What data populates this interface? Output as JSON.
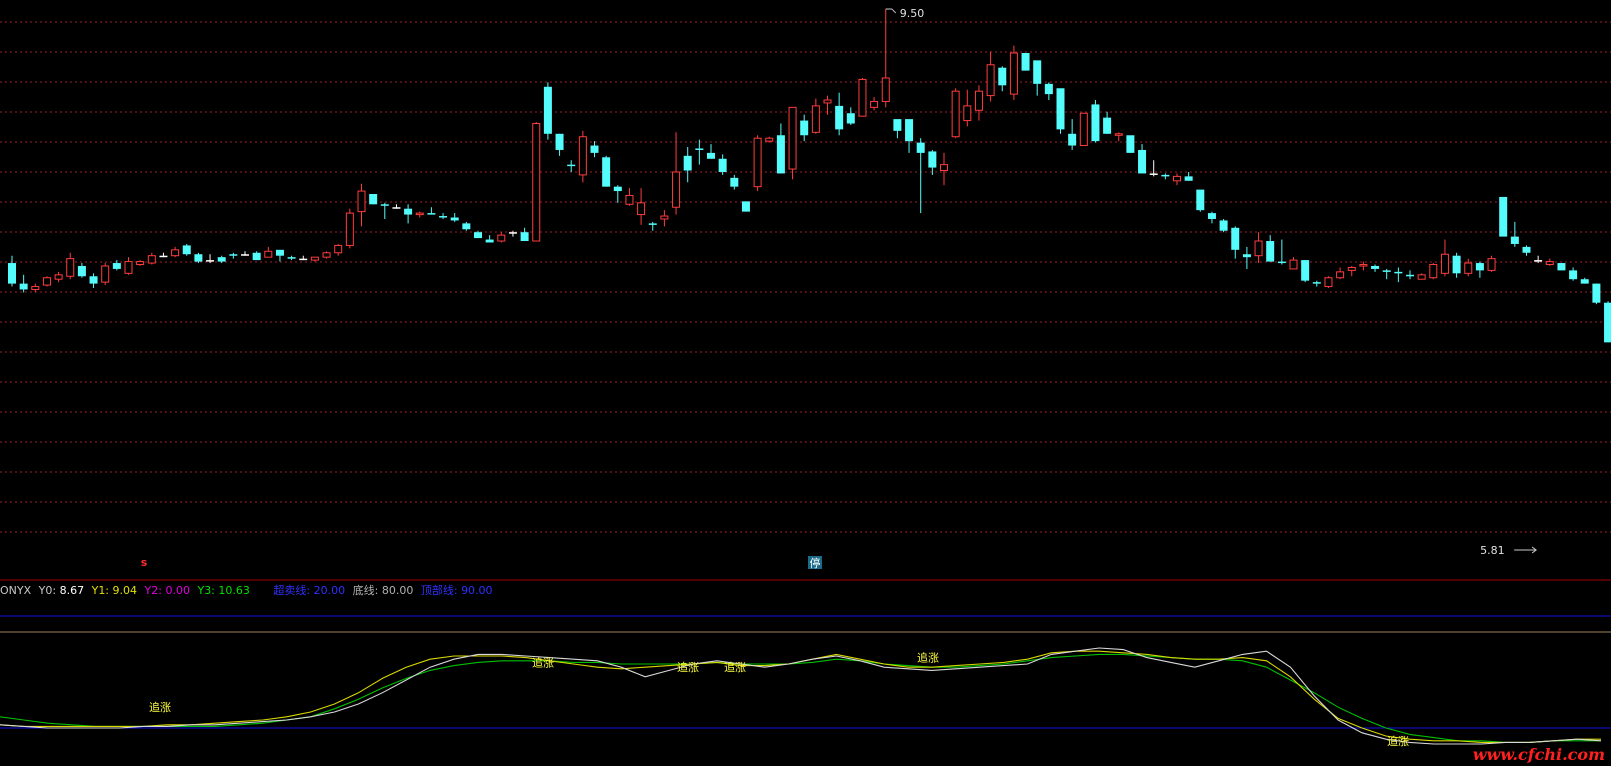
{
  "chart_data": {
    "type": "candlestick",
    "price_marks": {
      "high_label": "9.50",
      "low_label": "5.81"
    },
    "candles": [
      [
        7.75,
        7.8,
        7.59,
        7.61
      ],
      [
        7.61,
        7.67,
        7.55,
        7.57
      ],
      [
        7.57,
        7.61,
        7.55,
        7.59
      ],
      [
        7.6,
        7.66,
        7.59,
        7.65
      ],
      [
        7.64,
        7.69,
        7.62,
        7.67
      ],
      [
        7.66,
        7.82,
        7.64,
        7.78
      ],
      [
        7.73,
        7.75,
        7.65,
        7.66
      ],
      [
        7.66,
        7.68,
        7.58,
        7.61
      ],
      [
        7.62,
        7.75,
        7.6,
        7.73
      ],
      [
        7.75,
        7.77,
        7.7,
        7.71
      ],
      [
        7.68,
        7.79,
        7.67,
        7.76
      ],
      [
        7.74,
        7.77,
        7.73,
        7.76
      ],
      [
        7.75,
        7.82,
        7.74,
        7.8
      ],
      [
        7.8,
        7.82,
        7.79,
        7.8
      ],
      [
        7.8,
        7.86,
        7.79,
        7.84
      ],
      [
        7.87,
        7.88,
        7.8,
        7.81
      ],
      [
        7.81,
        7.82,
        7.75,
        7.76
      ],
      [
        7.77,
        7.81,
        7.75,
        7.77
      ],
      [
        7.79,
        7.8,
        7.75,
        7.76
      ],
      [
        7.81,
        7.82,
        7.78,
        7.8
      ],
      [
        7.81,
        7.83,
        7.8,
        7.81
      ],
      [
        7.82,
        7.83,
        7.77,
        7.77
      ],
      [
        7.79,
        7.86,
        7.79,
        7.83
      ],
      [
        7.84,
        7.84,
        7.76,
        7.8
      ],
      [
        7.79,
        7.8,
        7.77,
        7.78
      ],
      [
        7.78,
        7.8,
        7.77,
        7.78
      ],
      [
        7.77,
        7.79,
        7.76,
        7.79
      ],
      [
        7.79,
        7.83,
        7.78,
        7.82
      ],
      [
        7.82,
        7.88,
        7.8,
        7.87
      ],
      [
        7.87,
        8.12,
        7.85,
        8.09
      ],
      [
        8.1,
        8.29,
        8.0,
        8.24
      ],
      [
        8.22,
        8.2,
        8.15,
        8.15
      ],
      [
        8.15,
        8.16,
        8.05,
        8.14
      ],
      [
        8.13,
        8.15,
        8.12,
        8.13
      ],
      [
        8.12,
        8.15,
        8.02,
        8.08
      ],
      [
        8.08,
        8.1,
        8.06,
        8.09
      ],
      [
        8.09,
        8.13,
        8.08,
        8.08
      ],
      [
        8.07,
        8.09,
        8.05,
        8.06
      ],
      [
        8.06,
        8.09,
        8.03,
        8.04
      ],
      [
        8.02,
        8.03,
        7.97,
        7.98
      ],
      [
        7.96,
        7.97,
        7.92,
        7.92
      ],
      [
        7.91,
        7.94,
        7.89,
        7.89
      ],
      [
        7.9,
        7.96,
        7.89,
        7.94
      ],
      [
        7.96,
        7.97,
        7.93,
        7.96
      ],
      [
        7.96,
        7.99,
        7.9,
        7.9
      ],
      [
        7.9,
        8.71,
        7.9,
        8.7
      ],
      [
        8.95,
        8.98,
        8.59,
        8.63
      ],
      [
        8.63,
        8.63,
        8.48,
        8.52
      ],
      [
        8.42,
        8.45,
        8.37,
        8.41
      ],
      [
        8.35,
        8.65,
        8.3,
        8.61
      ],
      [
        8.55,
        8.58,
        8.47,
        8.5
      ],
      [
        8.47,
        8.48,
        8.27,
        8.27
      ],
      [
        8.27,
        8.28,
        8.16,
        8.24
      ],
      [
        8.15,
        8.26,
        8.14,
        8.21
      ],
      [
        8.08,
        8.26,
        8.01,
        8.16
      ],
      [
        8.02,
        8.03,
        7.97,
        8.01
      ],
      [
        8.05,
        8.11,
        8.0,
        8.07
      ],
      [
        8.13,
        8.64,
        8.08,
        8.37
      ],
      [
        8.48,
        8.54,
        8.3,
        8.38
      ],
      [
        8.53,
        8.59,
        8.42,
        8.52
      ],
      [
        8.5,
        8.56,
        8.46,
        8.46
      ],
      [
        8.46,
        8.49,
        8.35,
        8.37
      ],
      [
        8.33,
        8.35,
        8.25,
        8.27
      ],
      [
        8.17,
        8.17,
        8.1,
        8.1
      ],
      [
        8.27,
        8.62,
        8.24,
        8.6
      ],
      [
        8.58,
        8.61,
        8.57,
        8.6
      ],
      [
        8.62,
        8.7,
        8.36,
        8.36
      ],
      [
        8.39,
        8.81,
        8.32,
        8.81
      ],
      [
        8.72,
        8.76,
        8.58,
        8.62
      ],
      [
        8.64,
        8.87,
        8.63,
        8.82
      ],
      [
        8.84,
        8.89,
        8.76,
        8.86
      ],
      [
        8.82,
        8.91,
        8.62,
        8.66
      ],
      [
        8.77,
        8.81,
        8.69,
        8.7
      ],
      [
        8.75,
        9.01,
        8.75,
        9.0
      ],
      [
        8.81,
        8.88,
        8.79,
        8.85
      ],
      [
        8.85,
        9.48,
        8.81,
        9.01
      ],
      [
        8.73,
        8.7,
        8.6,
        8.65
      ],
      [
        8.73,
        8.7,
        8.5,
        8.58
      ],
      [
        8.57,
        8.6,
        8.09,
        8.5
      ],
      [
        8.51,
        8.52,
        8.35,
        8.4
      ],
      [
        8.38,
        8.5,
        8.28,
        8.42
      ],
      [
        8.61,
        8.94,
        8.6,
        8.92
      ],
      [
        8.72,
        8.93,
        8.68,
        8.82
      ],
      [
        8.79,
        8.96,
        8.72,
        8.92
      ],
      [
        8.89,
        9.19,
        8.85,
        9.1
      ],
      [
        9.08,
        9.09,
        8.92,
        8.96
      ],
      [
        8.9,
        9.23,
        8.86,
        9.18
      ],
      [
        9.18,
        9.16,
        9.06,
        9.06
      ],
      [
        9.13,
        9.09,
        8.89,
        8.97
      ],
      [
        8.97,
        8.98,
        8.86,
        8.9
      ],
      [
        8.94,
        8.93,
        8.63,
        8.66
      ],
      [
        8.63,
        8.73,
        8.52,
        8.55
      ],
      [
        8.55,
        8.77,
        8.57,
        8.77
      ],
      [
        8.83,
        8.86,
        8.57,
        8.58
      ],
      [
        8.74,
        8.78,
        8.63,
        8.63
      ],
      [
        8.62,
        8.64,
        8.58,
        8.63
      ],
      [
        8.62,
        8.59,
        8.5,
        8.5
      ],
      [
        8.52,
        8.56,
        8.36,
        8.36
      ],
      [
        8.36,
        8.45,
        8.34,
        8.36
      ],
      [
        8.35,
        8.36,
        8.32,
        8.34
      ],
      [
        8.31,
        8.36,
        8.28,
        8.34
      ],
      [
        8.34,
        8.37,
        8.31,
        8.31
      ],
      [
        8.25,
        8.24,
        8.1,
        8.11
      ],
      [
        8.09,
        8.1,
        8.02,
        8.05
      ],
      [
        8.04,
        8.05,
        7.96,
        7.97
      ],
      [
        7.99,
        8.0,
        7.78,
        7.84
      ],
      [
        7.81,
        7.86,
        7.71,
        7.79
      ],
      [
        7.8,
        7.96,
        7.75,
        7.9
      ],
      [
        7.9,
        7.94,
        7.76,
        7.76
      ],
      [
        7.76,
        7.91,
        7.74,
        7.75
      ],
      [
        7.71,
        7.79,
        7.71,
        7.77
      ],
      [
        7.77,
        7.77,
        7.62,
        7.63
      ],
      [
        7.62,
        7.63,
        7.59,
        7.61
      ],
      [
        7.59,
        7.66,
        7.58,
        7.65
      ],
      [
        7.65,
        7.72,
        7.64,
        7.69
      ],
      [
        7.7,
        7.73,
        7.66,
        7.72
      ],
      [
        7.73,
        7.76,
        7.7,
        7.74
      ],
      [
        7.73,
        7.74,
        7.69,
        7.71
      ],
      [
        7.7,
        7.71,
        7.64,
        7.69
      ],
      [
        7.69,
        7.72,
        7.62,
        7.68
      ],
      [
        7.67,
        7.7,
        7.64,
        7.66
      ],
      [
        7.64,
        7.68,
        7.64,
        7.67
      ],
      [
        7.65,
        7.75,
        7.64,
        7.74
      ],
      [
        7.68,
        7.91,
        7.66,
        7.81
      ],
      [
        7.8,
        7.82,
        7.65,
        7.68
      ],
      [
        7.68,
        7.78,
        7.66,
        7.75
      ],
      [
        7.75,
        7.76,
        7.65,
        7.7
      ],
      [
        7.7,
        7.8,
        7.69,
        7.78
      ],
      [
        8.2,
        8.2,
        8.16,
        7.93
      ],
      [
        7.93,
        8.03,
        7.86,
        7.88
      ],
      [
        7.86,
        7.87,
        7.8,
        7.82
      ],
      [
        7.77,
        7.8,
        7.75,
        7.77
      ],
      [
        7.74,
        7.78,
        7.73,
        7.76
      ],
      [
        7.75,
        7.75,
        7.7,
        7.7
      ],
      [
        7.7,
        7.72,
        7.63,
        7.64
      ],
      [
        7.64,
        7.65,
        7.61,
        7.61
      ],
      [
        7.61,
        7.61,
        7.47,
        7.48
      ],
      [
        7.48,
        7.49,
        7.21,
        7.21
      ],
      [
        7.21,
        7.2,
        7.09,
        7.1
      ],
      [
        7.05,
        7.06,
        7.01,
        7.1
      ],
      [
        7.08,
        7.08,
        6.85,
        6.89
      ],
      [
        6.88,
        6.93,
        6.85,
        6.92
      ],
      [
        6.9,
        6.93,
        6.89,
        6.89
      ]
    ],
    "indicator": {
      "name": "ONYX",
      "legend": {
        "y0": {
          "label": "Y0:",
          "value": "8.67"
        },
        "y1": {
          "label": "Y1:",
          "value": "9.04"
        },
        "y2": {
          "label": "Y2:",
          "value": "0.00"
        },
        "y3": {
          "label": "Y3:",
          "value": "10.63"
        },
        "oversold": {
          "label": "超卖线:",
          "value": "20.00"
        },
        "bottom": {
          "label": "底线:",
          "value": "80.00"
        },
        "top": {
          "label": "顶部线:",
          "value": "90.00"
        }
      },
      "white": [
        22,
        21,
        20,
        20,
        20,
        20,
        21,
        21,
        22,
        22,
        23,
        24,
        25,
        27,
        30,
        35,
        42,
        50,
        58,
        63,
        66,
        66,
        65,
        64,
        63,
        62,
        58,
        52,
        56,
        60,
        62,
        60,
        58,
        60,
        63,
        65,
        62,
        58,
        57,
        56,
        57,
        58,
        59,
        60,
        66,
        68,
        70,
        69,
        64,
        61,
        58,
        62,
        66,
        68,
        58,
        40,
        25,
        17,
        13,
        11,
        10,
        10,
        10,
        11,
        11,
        12,
        13,
        12
      ],
      "yellow": [
        22,
        21,
        21,
        21,
        21,
        21,
        21,
        22,
        22,
        23,
        24,
        25,
        27,
        30,
        35,
        42,
        51,
        58,
        63,
        65,
        65,
        65,
        64,
        62,
        60,
        58,
        57,
        58,
        59,
        60,
        61,
        59,
        59,
        60,
        63,
        66,
        63,
        60,
        58,
        58,
        59,
        60,
        61,
        63,
        67,
        68,
        68,
        67,
        66,
        64,
        63,
        63,
        64,
        62,
        52,
        38,
        26,
        20,
        15,
        13,
        12,
        12,
        11,
        11,
        11,
        12,
        13,
        13
      ],
      "green": [
        27,
        25,
        23,
        22,
        21,
        21,
        21,
        21,
        21,
        21,
        22,
        23,
        25,
        27,
        32,
        38,
        45,
        51,
        56,
        59,
        61,
        62,
        62,
        62,
        61,
        61,
        60,
        60,
        60,
        60,
        61,
        60,
        60,
        60,
        61,
        63,
        62,
        60,
        59,
        58,
        58,
        59,
        60,
        62,
        64,
        65,
        66,
        66,
        65,
        64,
        63,
        63,
        62,
        58,
        50,
        42,
        33,
        26,
        20,
        16,
        14,
        12,
        12,
        11,
        11,
        12,
        12,
        12
      ],
      "markers": [
        "追涨",
        "追涨",
        "追涨",
        "追涨",
        "追涨",
        "追涨"
      ],
      "top_marker": "停",
      "b_marker": "s"
    },
    "colors": {
      "up": "#ff3c3c",
      "down": "#54fcfc",
      "doji": "#ffffff",
      "grid": "#a0202a",
      "white_line": "#d8d8d8",
      "yellow_line": "#d8d800",
      "green_line": "#00c000",
      "blue_line": "#1010e0",
      "brown_line": "#a08060",
      "divider": "#a00000"
    }
  },
  "watermark": "www.cfchi.com"
}
